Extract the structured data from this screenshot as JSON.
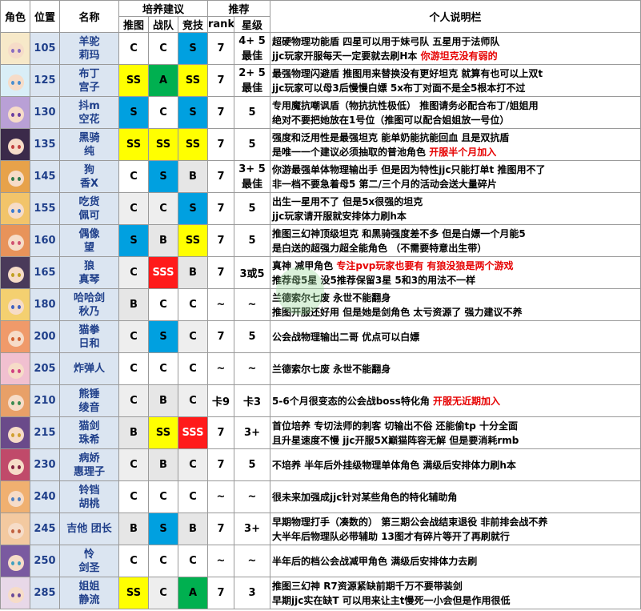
{
  "header": {
    "avatar": "角色",
    "pos": "位置",
    "name": "名称",
    "training": "培养建议",
    "recommend": "推荐",
    "note": "个人说明栏",
    "sub_push": "推图",
    "sub_clan": "战队",
    "sub_arena": "竞技",
    "sub_rank": "rank",
    "sub_star": "星级"
  },
  "colors": {
    "SS": "#ffff00",
    "S": "#00a0e0",
    "A": "#00b050",
    "SSS": "#ff1a1a",
    "B": "#e6e6e6",
    "pos_bg": "#dbe5f1",
    "name_text": "#1f3f8a",
    "highlight_text": "#e60000"
  },
  "rows": [
    {
      "pos": "105",
      "name": [
        "羊驼",
        "莉玛"
      ],
      "push": "C",
      "clan": "C",
      "arena": "S",
      "rank": "7",
      "star": "4+ 5最佳",
      "notes": [
        [
          {
            "t": "超硬物理功能盾 四星可以用于妹弓队 五星用于法师队"
          }
        ],
        [
          {
            "t": "jjc玩家开服每天一定要就去刷H本 "
          },
          {
            "t": "你游坦克没有弱的",
            "hl": true
          }
        ]
      ],
      "avatar": {
        "hair": "#f7e9c9",
        "eye": "#8a6cc0"
      }
    },
    {
      "pos": "125",
      "name": [
        "布丁",
        "宫子"
      ],
      "push": "SS",
      "clan": "A",
      "arena": "SS",
      "rank": "7",
      "star": "2+ 5最佳",
      "notes": [
        [
          {
            "t": "最强物理闪避盾 推图用来替换没有更好坦克 就算有也可以上双t"
          }
        ],
        [
          {
            "t": "jjc玩家可以母3后慢慢白嫖 5x布丁对面不是全5根本打不过"
          }
        ]
      ],
      "avatar": {
        "hair": "#d9eef7",
        "eye": "#4a8fd0"
      }
    },
    {
      "pos": "130",
      "name": [
        "抖m",
        "空花"
      ],
      "push": "S",
      "clan": "C",
      "arena": "S",
      "rank": "7",
      "star": "5",
      "notes": [
        [
          {
            "t": "专用魔抗嘲讽盾（物抗抗性极低） 推图请务必配合布丁/姐姐用"
          }
        ],
        [
          {
            "t": "绝对不要把她放在1号位（推图可以配合姐姐放一号位）"
          }
        ]
      ],
      "avatar": {
        "hair": "#b9a0d6",
        "eye": "#6a3fa0"
      }
    },
    {
      "pos": "135",
      "name": [
        "黑骑",
        "纯"
      ],
      "push": "SS",
      "clan": "SS",
      "arena": "SS",
      "rank": "7",
      "star": "5",
      "notes": [
        [
          {
            "t": "强度和泛用性是最强坦克 能单奶能抗能回血 且是双抗盾"
          }
        ],
        [
          {
            "t": "是唯一一个建议必须抽取的普池角色 "
          },
          {
            "t": "开服半个月加入",
            "hl": true
          }
        ]
      ],
      "avatar": {
        "hair": "#3b2a4a",
        "eye": "#c04040"
      }
    },
    {
      "pos": "145",
      "name": [
        "狗",
        "香X"
      ],
      "push": "C",
      "clan": "S",
      "arena": "B",
      "rank": "7",
      "star": "3+ 5最佳",
      "notes": [
        [
          {
            "t": "你游最强单体物理输出手 但是因为特性jjc只能打单t 推图用不了"
          }
        ],
        [
          {
            "t": "非一档不要急着母5 第二/三个月的活动会送大量碎片"
          }
        ]
      ],
      "avatar": {
        "hair": "#e7a24a",
        "eye": "#2f7a4a"
      }
    },
    {
      "pos": "155",
      "name": [
        "吃货",
        "佩可"
      ],
      "push": "C",
      "clan": "C",
      "arena": "S",
      "rank": "7",
      "star": "5",
      "notes": [
        [
          {
            "t": "出生一星用不了 但是5x很强的坦克"
          }
        ],
        [
          {
            "t": " jjc玩家请开服就安排体力刷h本"
          }
        ]
      ],
      "avatar": {
        "hair": "#f2c46a",
        "eye": "#3a7ad0"
      }
    },
    {
      "pos": "160",
      "name": [
        "偶像",
        "望"
      ],
      "push": "S",
      "clan": "B",
      "arena": "SS",
      "rank": "7",
      "star": "5",
      "notes": [
        [
          {
            "t": "推图三幻神顶级坦克 和黑骑强度差不多 但是白嫖一个月能5"
          }
        ],
        [
          {
            "t": "是白送的超强力超全能角色 （不需要特意出生带）"
          }
        ]
      ],
      "avatar": {
        "hair": "#e8935a",
        "eye": "#d05070"
      }
    },
    {
      "pos": "165",
      "name": [
        "狼",
        "真琴"
      ],
      "push": "C",
      "clan": "SSS",
      "arena": "B",
      "rank": "7",
      "star": "3或5",
      "notes": [
        [
          {
            "t": "真神 减甲角色 "
          },
          {
            "t": "专注pvp玩家也要有 有狼没狼是两个游戏",
            "hl": true
          }
        ],
        [
          {
            "t": "推荐母5星 没5推荐保留3星 5和3的用法不一样"
          }
        ]
      ],
      "avatar": {
        "hair": "#4a3a5a",
        "eye": "#c0a020"
      }
    },
    {
      "pos": "180",
      "name": [
        "哈哈剑",
        "秋乃"
      ],
      "push": "B",
      "clan": "C",
      "arena": "C",
      "rank": "~",
      "star": "~",
      "notes": [
        [
          {
            "t": "兰德索尔七废 永世不能翻身"
          }
        ],
        [
          {
            "t": "推图开服还好用 但是她是剑角色 太亏资源了 强力建议不养"
          }
        ]
      ],
      "avatar": {
        "hair": "#f4d070",
        "eye": "#4060c0"
      }
    },
    {
      "pos": "200",
      "name": [
        "猫拳",
        "日和"
      ],
      "push": "C",
      "clan": "S",
      "arena": "C",
      "rank": "7",
      "star": "5",
      "notes": [
        [
          {
            "t": "公会战物理输出二哥 优点可以白嫖"
          }
        ]
      ],
      "avatar": {
        "hair": "#f09a6a",
        "eye": "#d06030"
      }
    },
    {
      "pos": "205",
      "name": [
        "炸弹人"
      ],
      "push": "C",
      "clan": "C",
      "arena": "C",
      "rank": "~",
      "star": "~",
      "notes": [
        [
          {
            "t": "兰德索尔七废 永世不能翻身"
          }
        ]
      ],
      "avatar": {
        "hair": "#f1c0d0",
        "eye": "#d04080"
      }
    },
    {
      "pos": "210",
      "name": [
        "熊锤",
        "绫音"
      ],
      "push": "C",
      "clan": "B",
      "arena": "C",
      "rank": "卡9",
      "star": "卡3",
      "notes": [
        [
          {
            "t": "5-6个月很变态的公会战boss特化角 "
          },
          {
            "t": "开服无近期加入",
            "hl": true
          }
        ]
      ],
      "avatar": {
        "hair": "#e8a068",
        "eye": "#3a8a50"
      }
    },
    {
      "pos": "215",
      "name": [
        "猫剑",
        "珠希"
      ],
      "push": "B",
      "clan": "SS",
      "arena": "SSS",
      "rank": "7",
      "star": "3+",
      "notes": [
        [
          {
            "t": "首位培养 专切法师的刺客 切输出不俗 还能偷tp 十分全面"
          }
        ],
        [
          {
            "t": "且升星速度不慢 jjc开服5X巅猫阵容无解 但是要消耗rmb"
          }
        ]
      ],
      "avatar": {
        "hair": "#6a4a8a",
        "eye": "#d0a030"
      }
    },
    {
      "pos": "230",
      "name": [
        "病娇",
        "惠理子"
      ],
      "push": "C",
      "clan": "B",
      "arena": "C",
      "rank": "7",
      "star": "5",
      "notes": [
        [
          {
            "t": "不培养 半年后外挂级物理单体角色 满级后安排体力刷h本"
          }
        ]
      ],
      "avatar": {
        "hair": "#c04a6a",
        "eye": "#802040"
      }
    },
    {
      "pos": "240",
      "name": [
        "铃铛",
        "胡桃"
      ],
      "push": "C",
      "clan": "C",
      "arena": "C",
      "rank": "~",
      "star": "~",
      "notes": [
        [
          {
            "t": "很未来加强成jjc针对某些角色的特化辅助角"
          }
        ]
      ],
      "avatar": {
        "hair": "#f0b070",
        "eye": "#5080c0"
      }
    },
    {
      "pos": "245",
      "name": [
        "吉他 团长"
      ],
      "push": "B",
      "clan": "S",
      "arena": "B",
      "rank": "7",
      "star": "3+",
      "notes": [
        [
          {
            "t": "早期物理打手（凑数的） 第三期公会战结束退役 非前排会战不养"
          }
        ],
        [
          {
            "t": "大半年后物理队必带辅助 13图才有碎片等开了再刷就行"
          }
        ]
      ],
      "avatar": {
        "hair": "#f3c9a0",
        "eye": "#c06040"
      }
    },
    {
      "pos": "250",
      "name": [
        "怜",
        "剑圣"
      ],
      "push": "C",
      "clan": "C",
      "arena": "C",
      "rank": "~",
      "star": "~",
      "notes": [
        [
          {
            "t": "半年后的档公会战减甲角色 满级后安排体力去刷"
          }
        ]
      ],
      "avatar": {
        "hair": "#7a5aa0",
        "eye": "#40a0c0"
      }
    },
    {
      "pos": "285",
      "name": [
        "姐姐",
        "静流"
      ],
      "push": "SS",
      "clan": "C",
      "arena": "A",
      "rank": "7",
      "star": "3",
      "notes": [
        [
          {
            "t": "推图三幻神 R7资源紧缺前期千万不要带装剑"
          }
        ],
        [
          {
            "t": "早期jjc实在缺T 可以用来让主t慢死一小会但是作用很低"
          }
        ]
      ],
      "avatar": {
        "hair": "#e8d8e8",
        "eye": "#6a4a9a"
      }
    }
  ]
}
